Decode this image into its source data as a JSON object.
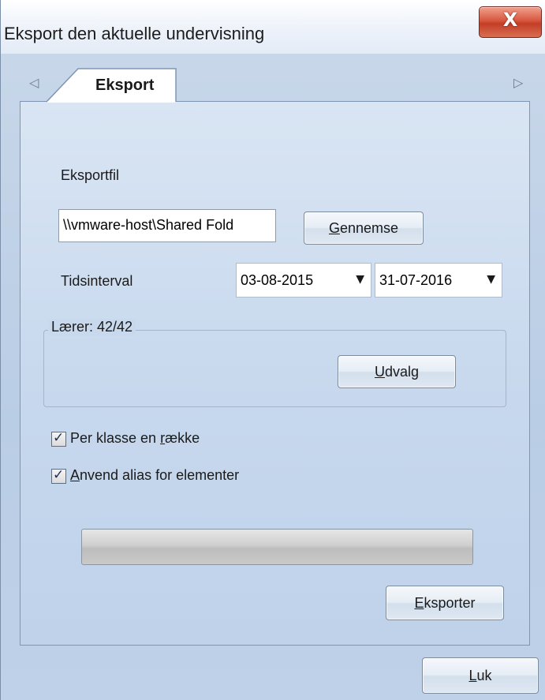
{
  "window": {
    "title": "Eksport den aktuelle undervisning",
    "close_glyph": "X"
  },
  "tabs": {
    "left_arrow": "◁",
    "right_arrow": "▷",
    "items": [
      {
        "label": "Eksport",
        "active": true
      }
    ]
  },
  "export_file": {
    "label": "Eksportfil",
    "value": "\\\\vmware-host\\Shared Fold",
    "browse_pre": "",
    "browse_key": "G",
    "browse_post": "ennemse"
  },
  "time_interval": {
    "label": "Tidsinterval",
    "from": "03-08-2015",
    "to": "31-07-2016",
    "dropdown_glyph": "▼"
  },
  "teachers_group": {
    "title": "Lærer: 42/42",
    "select_key": "U",
    "select_post": "dvalg"
  },
  "options": {
    "per_class_pre": "Per klasse en ",
    "per_class_key": "r",
    "per_class_post": "ække",
    "per_class_checked": true,
    "alias_pre": "",
    "alias_key": "A",
    "alias_post": "nvend alias for elementer",
    "alias_checked": true,
    "check_glyph": "✓"
  },
  "progress": {
    "fraction": 0.0
  },
  "buttons": {
    "export_key": "E",
    "export_post": "ksporter",
    "close_key": "L",
    "close_post": "uk"
  },
  "colors": {
    "close_button": "#c33e26",
    "panel_background": "#c8d9ee"
  }
}
